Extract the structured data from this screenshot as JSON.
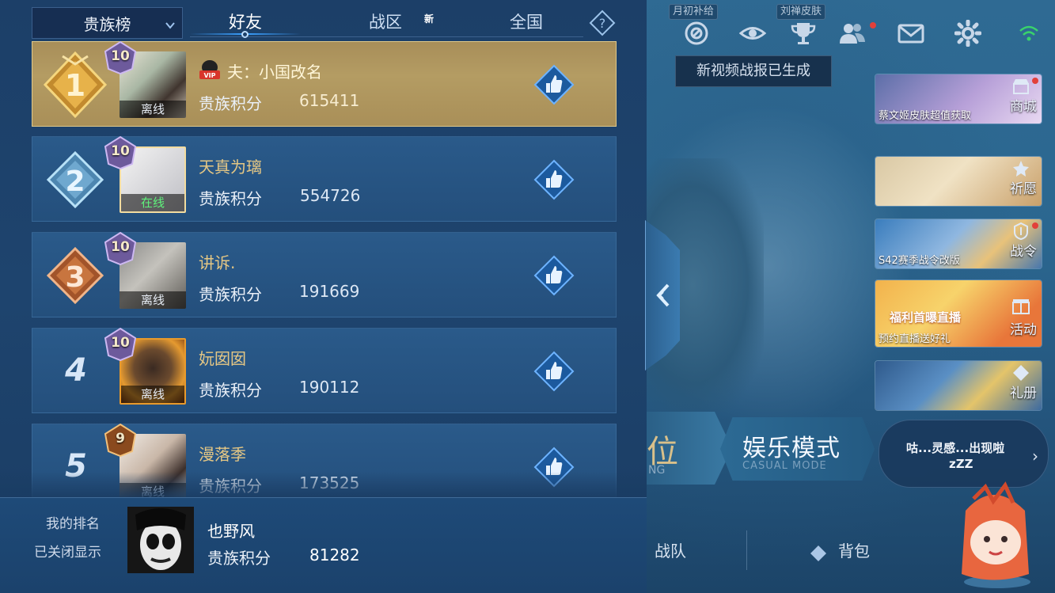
{
  "tabs": {
    "noble_select": "贵族榜",
    "friends": "好友",
    "zone": "战区",
    "zone_badge": "新",
    "national": "全国"
  },
  "score_label": "贵族积分",
  "rows": [
    {
      "rank": "1",
      "level": "10",
      "name": "夫：小国改名",
      "status": "离线",
      "score": "615411",
      "vip": "VIP"
    },
    {
      "rank": "2",
      "level": "10",
      "name": "天真为璃",
      "status": "在线",
      "score": "554726"
    },
    {
      "rank": "3",
      "level": "10",
      "name": "讲诉.",
      "status": "离线",
      "score": "191669"
    },
    {
      "rank": "4",
      "level": "10",
      "name": "妧囡囡",
      "status": "离线",
      "score": "190112"
    },
    {
      "rank": "5",
      "level": "9",
      "name": "漫落季",
      "status": "离线",
      "score": "173525"
    }
  ],
  "my_rank": {
    "label": "我的排名",
    "value": "已关闭显示",
    "name": "也野风",
    "score": "81282"
  },
  "lobby": {
    "tag_monthly": "月初补给",
    "tag_skin": "刘禅皮肤",
    "toast": "新视频战报已生成",
    "cards": [
      {
        "label": "商城",
        "text": "蔡文姬皮肤超值获取"
      },
      {
        "label": "祈愿",
        "text": ""
      },
      {
        "label": "战令",
        "text": "S42赛季战令改版"
      },
      {
        "label": "活动",
        "text": "预约直播送好礼",
        "art_text": "福利首曝直播"
      },
      {
        "label": "礼册",
        "text": ""
      }
    ],
    "mode_rank": "位",
    "mode_rank_en": "NG",
    "mode_casual": "娱乐模式",
    "mode_casual_en": "CASUAL MODE",
    "bubble_line1": "咕...灵感...出现啦",
    "bubble_line2": "zZZ",
    "nav_team": "战队",
    "nav_bag": "背包"
  },
  "colors": {
    "accent_gold": "#e5c784",
    "online_green": "#5ff27b",
    "badge_red": "#d6322c"
  }
}
